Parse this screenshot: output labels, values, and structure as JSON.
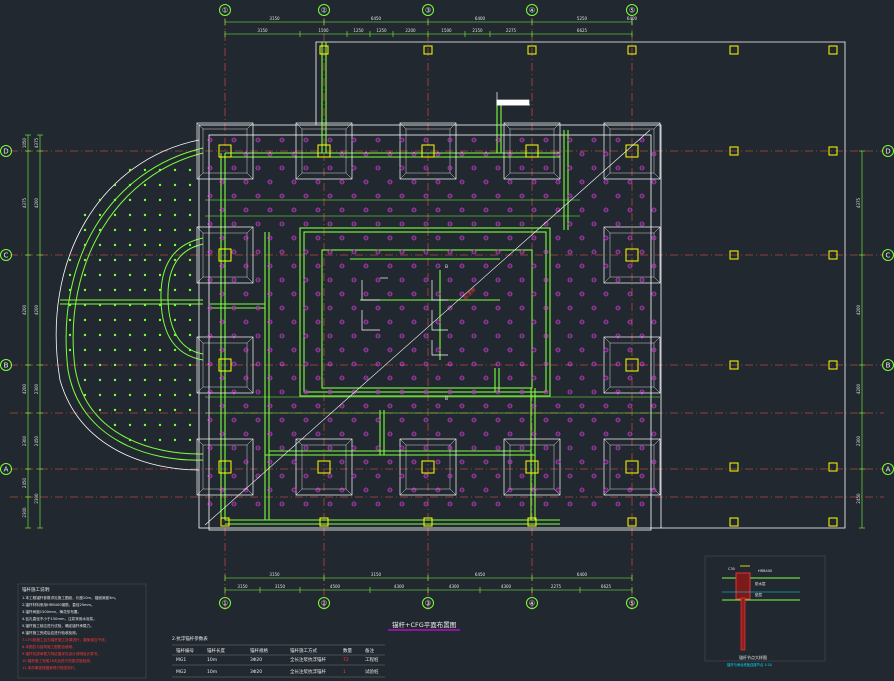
{
  "drawing": {
    "title": "锚杆+CFG平面布置图",
    "grid_columns": [
      "①",
      "②",
      "③",
      "④",
      "⑤"
    ],
    "grid_rows": [
      "D",
      "C",
      "B",
      "A"
    ],
    "top_dims_row1": [
      "3150",
      "6450",
      "6400",
      "5250",
      "6400"
    ],
    "top_dims_row2": [
      "3150",
      "1500",
      "1250",
      "1250",
      "2200",
      "1500",
      "2150",
      "2275",
      "6625"
    ],
    "bottom_dims_row1": [
      "3150",
      "3150",
      "6450",
      "6400",
      "5250",
      "6400"
    ],
    "bottom_dims_row2": [
      "3150",
      "3150",
      "4500",
      "4300",
      "4300",
      "4300",
      "2275",
      "6625"
    ],
    "left_dims": [
      "1050",
      "4375",
      "4200",
      "4200",
      "2300",
      "2450",
      "2300"
    ],
    "right_dims": [
      "4375",
      "4200",
      "4200",
      "2300",
      "2450"
    ],
    "zone_labels": [
      "B",
      "B"
    ],
    "notes_title": "锚杆施工说明:",
    "notes": [
      "1.本工程锚杆参数详见施工图纸，长度10m，锚固深度3m。",
      "2.锚杆材料采用HRB400钢筋，直径25mm。",
      "3.锚杆间距1500mm，梅花形布置。",
      "4.钻孔直径不小于150mm，注浆采用水泥浆。",
      "5.锚杆施工前应进行试验，确定锚杆承载力。",
      "6.锚杆施工完成后应进行验收检测。",
      "7.CFG桩施工应与锚杆施工协调进行，避免相互干扰。",
      "8.本图应与结构施工图配合使用。",
      "9.锚杆抗拔承载力特征值详见设计说明及计算书。",
      "10.锚杆施工完成28天后进行抗拔试验检测。",
      "11.未尽事宜按国家现行规范执行。"
    ],
    "table_title": "2.抗浮锚杆参数表",
    "table_headers": [
      "锚杆编号",
      "锚杆长度",
      "锚杆规格",
      "锚杆施工方式",
      "数量",
      "备注"
    ],
    "table_rows": [
      [
        "MG1",
        "10m",
        "3Φ20",
        "全长注浆抗浮锚杆",
        "72",
        "工程桩"
      ],
      [
        "MG2",
        "10m",
        "3Φ20",
        "全长注浆抗浮锚杆",
        "1",
        "试验桩"
      ]
    ],
    "detail_caption": "锚杆节点大样图",
    "detail_subcaption": "锚杆与承台底板连接节点 1:20"
  },
  "colors": {
    "background": "#212830",
    "grid_line": "#c8463c",
    "structure": "#ffffff",
    "beam": "#7dff3c",
    "anchor": "#d040d0",
    "pile_cap": "#ffff00",
    "axis_bubble": "#7dff3c",
    "note_red": "#ff3b3b"
  }
}
